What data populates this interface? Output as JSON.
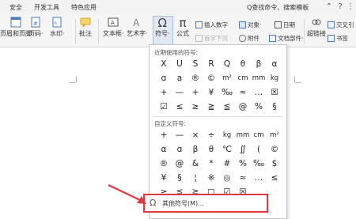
{
  "menubar": {
    "tabs": [
      "安全",
      "开发工具",
      "特色应用"
    ],
    "search": "Q查找命令、搜索模板"
  },
  "ribbon": {
    "header_footer": "页眉和页脚",
    "page_number": "页码·",
    "watermark": "水印·",
    "comment": "批注",
    "textbox": "文本框·",
    "wordart": "艺术字·",
    "symbol": "符号·",
    "formula": "公式",
    "insert_number": "插入数字",
    "object": "对象·",
    "date": "日期",
    "first_letter_sink": "首字下沉",
    "attachment": "附件",
    "doc_parts": "文档部件·",
    "hyperlink": "超链接",
    "cross_ref": "交叉引",
    "bookmark": "书签"
  },
  "dropdown": {
    "recent_title": "近期使用的符号:",
    "recent_symbols": [
      "X",
      "U",
      "S",
      "R",
      "Q",
      "θ",
      "β",
      "α",
      "ɑ",
      "a",
      "®",
      "©",
      "m²",
      "cm",
      "mm",
      "kg",
      "+",
      "—",
      "+",
      "¥",
      "‰",
      "≈",
      "…",
      "☒",
      "☑",
      "≤",
      "≥",
      "≧",
      "≦",
      "@",
      "%",
      "§"
    ],
    "custom_title": "自定义符号:",
    "custom_symbols": [
      "+",
      "—",
      "×",
      "÷",
      "kg",
      "mm",
      "cm",
      "m²",
      "α",
      "ɑ",
      "β",
      "θ",
      "℃",
      "∬",
      "(",
      "©",
      "®",
      "@",
      "&",
      "*",
      "#",
      "%",
      "‰",
      "$",
      "¥",
      "§",
      "¦",
      "※",
      "◎",
      "≈",
      "…",
      "≤",
      "≥",
      "≦",
      "≧",
      "□",
      "☑",
      "☒"
    ],
    "more_label": "其他符号(M)..."
  },
  "colors": {
    "highlight_border": "#e0393e",
    "arrow": "#e0393e"
  }
}
